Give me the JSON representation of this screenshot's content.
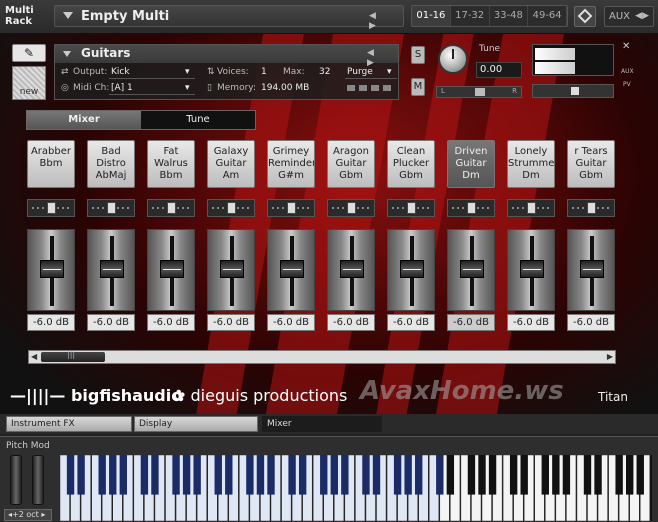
{
  "topbar": {
    "rack_label": "Multi Rack",
    "multi_name": "Empty Multi",
    "nav_arrows": "◀ ▶",
    "page_tabs": [
      "01-16",
      "17-32",
      "33-48",
      "49-64"
    ],
    "active_page": "01-16",
    "aux_label": "AUX"
  },
  "instrument": {
    "name": "Guitars",
    "output_label": "Output:",
    "output_value": "Kick",
    "voices_label": "Voices:",
    "voices_value": "1",
    "max_label": "Max:",
    "max_value": "32",
    "purge_label": "Purge",
    "midi_label": "Midi Ch:",
    "midi_value": "[A] 1",
    "memory_label": "Memory:",
    "memory_value": "194.00 MB",
    "solo_label": "S",
    "mute_label": "M",
    "tune_label": "Tune",
    "tune_value": "0.00",
    "pan_left": "L",
    "pan_right": "R",
    "aux_label": "AUX",
    "pv_label": "PV",
    "news_label": "new"
  },
  "tabs": {
    "mixer": "Mixer",
    "tune": "Tune",
    "active": "Mixer"
  },
  "channels": [
    {
      "name": "Arabber Bbm",
      "db": "-6.0 dB"
    },
    {
      "name": "Bad Distro AbMaj",
      "db": "-6.0 dB"
    },
    {
      "name": "Fat Walrus Bbm",
      "db": "-6.0 dB"
    },
    {
      "name": "Galaxy Guitar Am",
      "db": "-6.0 dB"
    },
    {
      "name": "Grimey Reminder G#m",
      "db": "-6.0 dB"
    },
    {
      "name": "Aragon Guitar Gbm",
      "db": "-6.0 dB"
    },
    {
      "name": "Clean Plucker Gbm",
      "db": "-6.0 dB"
    },
    {
      "name": "Driven Guitar Dm",
      "db": "-6.0 dB"
    },
    {
      "name": "Lonely Strummer Dm",
      "db": "-6.0 dB"
    },
    {
      "name": "r Tears Guitar Gbm",
      "db": "-6.0 dB"
    }
  ],
  "selected_channel": "Driven Guitar Dm",
  "logos": {
    "brand1": "—||||— bigfishaudio",
    "brand2": "dieguis productions",
    "watermark": "AvaxHome.ws",
    "product": "Titan"
  },
  "bottom_tabs": [
    "Instrument FX",
    "Display",
    "Mixer"
  ],
  "active_bottom_tab": "Mixer",
  "keyboard": {
    "pitch_mod_label": "Pitch Mod",
    "octave_label": "+2 oct"
  },
  "colors": {
    "background_red": "#8a1010",
    "button_light": "#e6e6e6",
    "selected_dark": "#555555"
  }
}
